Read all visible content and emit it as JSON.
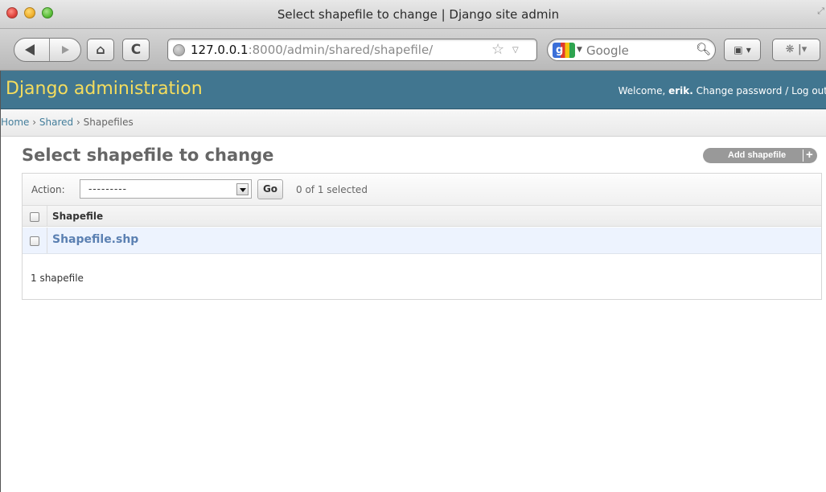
{
  "window": {
    "title": "Select shapefile to change | Django site admin"
  },
  "toolbar": {
    "url_host": "127.0.0.1",
    "url_path": ":8000/admin/shared/shapefile/",
    "search_engine": "Google",
    "search_engine_logo_letter": "g"
  },
  "header": {
    "brand": "Django administration",
    "welcome": "Welcome,",
    "username": "erik",
    "change_password": "Change password",
    "separator": "/",
    "logout": "Log out"
  },
  "breadcrumbs": {
    "home": "Home",
    "app": "Shared",
    "current": "Shapefiles",
    "separator": "›"
  },
  "content": {
    "title": "Select shapefile to change",
    "add_button": "Add shapefile"
  },
  "actions": {
    "label": "Action:",
    "select_value": "---------",
    "go_label": "Go",
    "selected_count": "0 of 1 selected"
  },
  "table": {
    "column_header": "Shapefile",
    "rows": [
      {
        "name": "Shapefile.shp"
      }
    ]
  },
  "paginator": "1 shapefile",
  "colors": {
    "header_bg": "#417690",
    "brand_text": "#f5dd5d",
    "link": "#447e9b",
    "row_link": "#5b80b2",
    "row_bg": "#edf3fe"
  },
  "icons": [
    "back-arrow-icon",
    "forward-arrow-icon",
    "home-icon",
    "reload-icon",
    "globe-icon",
    "bookmark-star-icon",
    "search-icon",
    "bookmarks-icon",
    "extension-icon",
    "plus-icon",
    "dropdown-arrow-icon"
  ]
}
